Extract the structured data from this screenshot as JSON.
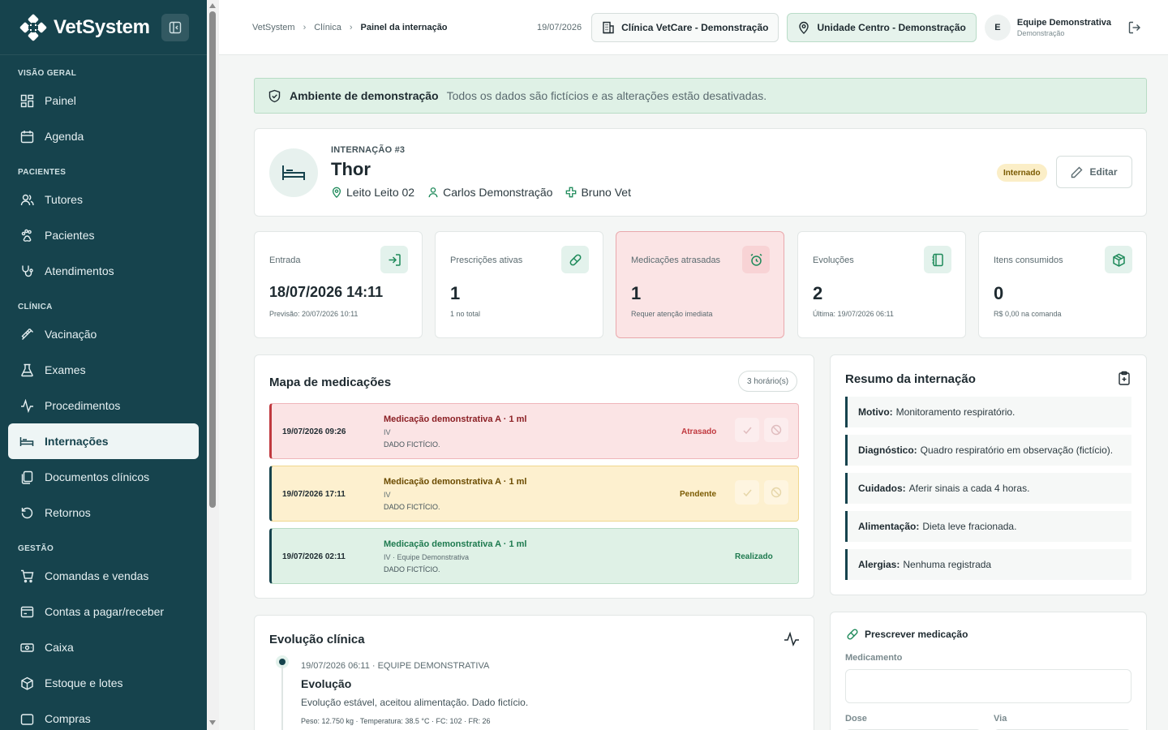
{
  "app": {
    "name": "VetSystem"
  },
  "sidebar": {
    "sections": [
      {
        "title": "VISÃO GERAL",
        "items": [
          {
            "label": "Painel",
            "icon": "dashboard-icon"
          },
          {
            "label": "Agenda",
            "icon": "calendar-icon"
          }
        ]
      },
      {
        "title": "PACIENTES",
        "items": [
          {
            "label": "Tutores",
            "icon": "users-icon"
          },
          {
            "label": "Pacientes",
            "icon": "paw-icon"
          },
          {
            "label": "Atendimentos",
            "icon": "stethoscope-icon"
          }
        ]
      },
      {
        "title": "CLÍNICA",
        "items": [
          {
            "label": "Vacinação",
            "icon": "syringe-icon"
          },
          {
            "label": "Exames",
            "icon": "flask-icon"
          },
          {
            "label": "Procedimentos",
            "icon": "activity-icon"
          },
          {
            "label": "Internações",
            "icon": "bed-icon",
            "active": true
          },
          {
            "label": "Documentos clínicos",
            "icon": "documents-icon"
          },
          {
            "label": "Retornos",
            "icon": "rotate-icon"
          }
        ]
      },
      {
        "title": "GESTÃO",
        "items": [
          {
            "label": "Comandas e vendas",
            "icon": "cart-icon"
          },
          {
            "label": "Contas a pagar/receber",
            "icon": "wallet-icon"
          },
          {
            "label": "Caixa",
            "icon": "cash-icon"
          },
          {
            "label": "Estoque e lotes",
            "icon": "box-icon"
          },
          {
            "label": "Compras",
            "icon": "purchase-icon"
          }
        ]
      }
    ]
  },
  "topbar": {
    "breadcrumb": [
      "VetSystem",
      "Clínica",
      "Painel da internação"
    ],
    "date": "19/07/2026",
    "clinic_button": "Clínica VetCare - Demonstração",
    "unit_button": "Unidade Centro - Demonstração",
    "user": {
      "initial": "E",
      "name": "Equipe Demonstrativa",
      "role": "Demonstração"
    }
  },
  "banner": {
    "title": "Ambiente de demonstração",
    "message": "Todos os dados são fictícios e as alterações estão desativadas."
  },
  "patient": {
    "eyebrow": "INTERNAÇÃO #3",
    "name": "Thor",
    "bed": "Leito Leito 02",
    "tutor": "Carlos Demonstração",
    "vet": "Bruno Vet",
    "status": "Internado",
    "edit_label": "Editar"
  },
  "stats": [
    {
      "label": "Entrada",
      "value": "18/07/2026 14:11",
      "sub": "Previsão: 20/07/2026 10:11",
      "icon": "login-icon"
    },
    {
      "label": "Prescrições ativas",
      "value": "1",
      "sub": "1 no total",
      "icon": "pill-icon"
    },
    {
      "label": "Medicações atrasadas",
      "value": "1",
      "sub": "Requer atenção imediata",
      "icon": "alarm-icon"
    },
    {
      "label": "Evoluções",
      "value": "2",
      "sub": "Última: 19/07/2026 06:11",
      "icon": "notebook-icon"
    },
    {
      "label": "Itens consumidos",
      "value": "0",
      "sub": "R$ 0,00 na comanda",
      "icon": "package-icon"
    }
  ],
  "med_map": {
    "title": "Mapa de medicações",
    "count": "3 horário(s)",
    "items": [
      {
        "datetime": "19/07/2026 09:26",
        "name": "Medicação demonstrativa A · 1 ml",
        "route": "IV",
        "note": "DADO FICTÍCIO.",
        "status": "Atrasado"
      },
      {
        "datetime": "19/07/2026 17:11",
        "name": "Medicação demonstrativa A · 1 ml",
        "route": "IV",
        "note": "DADO FICTÍCIO.",
        "status": "Pendente"
      },
      {
        "datetime": "19/07/2026 02:11",
        "name": "Medicação demonstrativa A · 1 ml",
        "route": "IV · Equipe Demonstrativa",
        "note": "DADO FICTÍCIO.",
        "status": "Realizado"
      }
    ]
  },
  "summary": {
    "title": "Resumo da internação",
    "items": [
      {
        "label": "Motivo:",
        "value": "Monitoramento respiratório."
      },
      {
        "label": "Diagnóstico:",
        "value": "Quadro respiratório em observação (fictício)."
      },
      {
        "label": "Cuidados:",
        "value": "Aferir sinais a cada 4 horas."
      },
      {
        "label": "Alimentação:",
        "value": "Dieta leve fracionada."
      },
      {
        "label": "Alergias:",
        "value": "Nenhuma registrada"
      }
    ]
  },
  "evolution": {
    "title": "Evolução clínica",
    "entry": {
      "meta": "19/07/2026 06:11 · EQUIPE DEMONSTRATIVA",
      "title": "Evolução",
      "text": "Evolução estável, aceitou alimentação. Dado fictício.",
      "vitals": "Peso: 12.750 kg · Temperatura: 38.5 °C · FC: 102 · FR: 26"
    }
  },
  "prescribe": {
    "title": "Prescrever medicação",
    "medicamento_label": "Medicamento",
    "dose_label": "Dose",
    "via_label": "Via"
  }
}
